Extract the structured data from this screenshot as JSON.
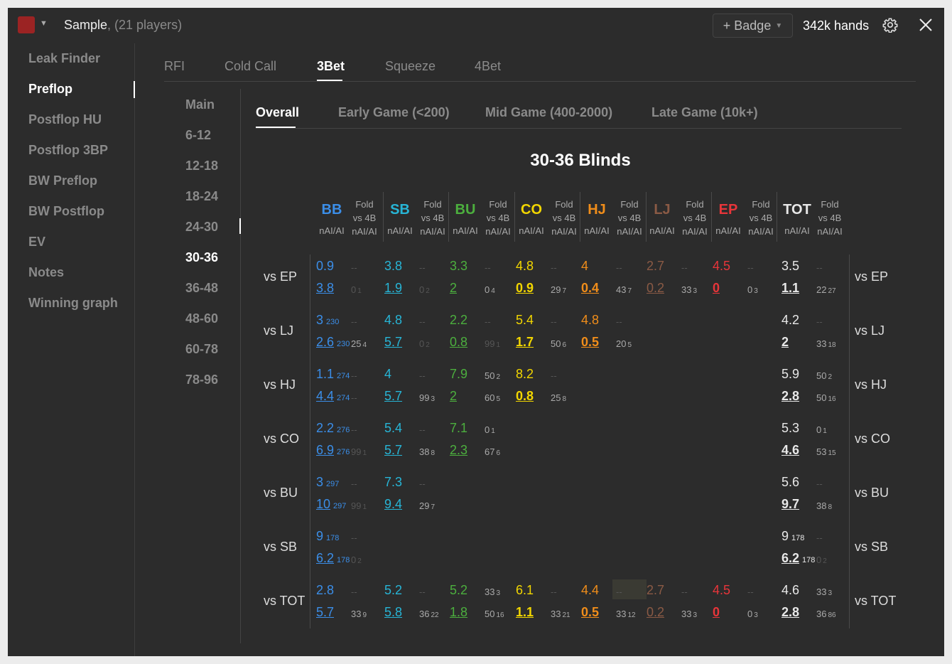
{
  "titlebar": {
    "swatch_color": "#9b2323",
    "title": "Sample",
    "subtitle": ", (21 players)",
    "badge_label": "+ Badge",
    "hands": "342k hands"
  },
  "sidebar": {
    "items": [
      {
        "label": "Leak Finder"
      },
      {
        "label": "Preflop",
        "active": true
      },
      {
        "label": "Postflop HU"
      },
      {
        "label": "Postflop 3BP"
      },
      {
        "label": "BW Preflop"
      },
      {
        "label": "BW Postflop"
      },
      {
        "label": "EV"
      },
      {
        "label": "Notes"
      },
      {
        "label": "Winning graph"
      }
    ]
  },
  "tabs": [
    "RFI",
    "Cold Call",
    "3Bet",
    "Squeeze",
    "4Bet"
  ],
  "ranges": [
    "Main",
    "6-12",
    "12-18",
    "18-24",
    "24-30",
    "30-36",
    "36-48",
    "48-60",
    "60-78",
    "78-96"
  ],
  "subtabs": [
    "Overall",
    "Early Game (<200)",
    "Mid Game (400-2000)",
    "Late Game (10k+)"
  ],
  "chart": {
    "title": "30-36 Blinds",
    "nai_label": "nAI/AI",
    "fold_label_1": "Fold",
    "fold_label_2": "vs 4B",
    "positions": [
      {
        "name": "BB",
        "color": "#3b8ee8"
      },
      {
        "name": "SB",
        "color": "#27b5d6"
      },
      {
        "name": "BU",
        "color": "#4caf3e"
      },
      {
        "name": "CO",
        "color": "#f2d600"
      },
      {
        "name": "HJ",
        "color": "#f08d1a"
      },
      {
        "name": "LJ",
        "color": "#8a5a45"
      },
      {
        "name": "EP",
        "color": "#e8353a"
      },
      {
        "name": "TOT",
        "color": "#e8e8e8"
      }
    ],
    "rows": [
      {
        "label": "vs EP",
        "cells": [
          {
            "pos": "BB",
            "top": "0.9",
            "bot": "3.8",
            "ftop": "--",
            "fbot": "0",
            "fbotc": "1"
          },
          {
            "pos": "SB",
            "top": "3.8",
            "bot": "1.9",
            "ftop": "--",
            "fbot": "0",
            "fbotc": "2"
          },
          {
            "pos": "BU",
            "top": "3.3",
            "bot": "2",
            "ftop": "--",
            "fbot": "0",
            "fbotc": "4"
          },
          {
            "pos": "CO",
            "top": "4.8",
            "bot": "0.9",
            "bold": true,
            "ftop": "--",
            "fbot": "29",
            "fbotc": "7"
          },
          {
            "pos": "HJ",
            "top": "4",
            "bot": "0.4",
            "bold": true,
            "ftop": "--",
            "fbot": "43",
            "fbotc": "7"
          },
          {
            "pos": "LJ",
            "top": "2.7",
            "bot": "0.2",
            "ftop": "--",
            "fbot": "33",
            "fbotc": "3"
          },
          {
            "pos": "EP",
            "top": "4.5",
            "bot": "0",
            "bold": true,
            "ftop": "--",
            "fbot": "0",
            "fbotc": "3"
          },
          {
            "pos": "TOT",
            "top": "3.5",
            "bot": "1.1",
            "bold": true,
            "ftop": "--",
            "fbot": "22",
            "fbotc": "27"
          }
        ]
      },
      {
        "label": "vs LJ",
        "cells": [
          {
            "pos": "BB",
            "top": "3",
            "topc": "230",
            "bot": "2.6",
            "botc": "230",
            "ftop": "--",
            "fbot": "25",
            "fbotc": "4"
          },
          {
            "pos": "SB",
            "top": "4.8",
            "bot": "5.7",
            "ftop": "--",
            "fbot": "0",
            "fbotc": "2"
          },
          {
            "pos": "BU",
            "top": "2.2",
            "bot": "0.8",
            "ftop": "--",
            "fbot": "99",
            "fbotc": "1"
          },
          {
            "pos": "CO",
            "top": "5.4",
            "bot": "1.7",
            "bold": true,
            "ftop": "--",
            "fbot": "50",
            "fbotc": "6"
          },
          {
            "pos": "HJ",
            "top": "4.8",
            "bot": "0.5",
            "bold": true,
            "ftop": "--",
            "fbot": "20",
            "fbotc": "5"
          },
          {
            "pos": "TOT",
            "top": "4.2",
            "bot": "2",
            "bold": true,
            "ftop": "--",
            "fbot": "33",
            "fbotc": "18"
          }
        ]
      },
      {
        "label": "vs HJ",
        "cells": [
          {
            "pos": "BB",
            "top": "1.1",
            "topc": "274",
            "bot": "4.4",
            "botc": "274",
            "ftop": "--",
            "fbot": "--"
          },
          {
            "pos": "SB",
            "top": "4",
            "bot": "5.7",
            "ftop": "--",
            "fbot": "99",
            "fbotc": "3"
          },
          {
            "pos": "BU",
            "top": "7.9",
            "bot": "2",
            "ftop": "50",
            "ftopc": "2",
            "fbot": "60",
            "fbotc": "5"
          },
          {
            "pos": "CO",
            "top": "8.2",
            "bot": "0.8",
            "bold": true,
            "ftop": "--",
            "fbot": "25",
            "fbotc": "8"
          },
          {
            "pos": "TOT",
            "top": "5.9",
            "bot": "2.8",
            "bold": true,
            "ftop": "50",
            "ftopc": "2",
            "fbot": "50",
            "fbotc": "16"
          }
        ]
      },
      {
        "label": "vs CO",
        "cells": [
          {
            "pos": "BB",
            "top": "2.2",
            "topc": "276",
            "bot": "6.9",
            "botc": "276",
            "ftop": "--",
            "fbot": "99",
            "fbotc": "1"
          },
          {
            "pos": "SB",
            "top": "5.4",
            "bot": "5.7",
            "ftop": "--",
            "fbot": "38",
            "fbotc": "8"
          },
          {
            "pos": "BU",
            "top": "7.1",
            "bot": "2.3",
            "ftop": "0",
            "ftopc": "1",
            "fbot": "67",
            "fbotc": "6"
          },
          {
            "pos": "TOT",
            "top": "5.3",
            "bot": "4.6",
            "bold": true,
            "ftop": "0",
            "ftopc": "1",
            "fbot": "53",
            "fbotc": "15"
          }
        ]
      },
      {
        "label": "vs BU",
        "cells": [
          {
            "pos": "BB",
            "top": "3",
            "topc": "297",
            "bot": "10",
            "botc": "297",
            "ftop": "--",
            "fbot": "99",
            "fbotc": "1"
          },
          {
            "pos": "SB",
            "top": "7.3",
            "bot": "9.4",
            "ftop": "--",
            "fbot": "29",
            "fbotc": "7"
          },
          {
            "pos": "TOT",
            "top": "5.6",
            "bot": "9.7",
            "bold": true,
            "ftop": "--",
            "fbot": "38",
            "fbotc": "8"
          }
        ]
      },
      {
        "label": "vs SB",
        "cells": [
          {
            "pos": "BB",
            "top": "9",
            "topc": "178",
            "bot": "6.2",
            "botc": "178",
            "ftop": "--",
            "fbot": "0",
            "fbotc": "2"
          },
          {
            "pos": "TOT",
            "top": "9",
            "topc": "178",
            "bot": "6.2",
            "botc": "178",
            "bold": true,
            "ftop": "--",
            "fbot": "0",
            "fbotc": "2"
          }
        ]
      },
      {
        "label": "vs TOT",
        "cells": [
          {
            "pos": "BB",
            "top": "2.8",
            "bot": "5.7",
            "ftop": "--",
            "fbot": "33",
            "fbotc": "9"
          },
          {
            "pos": "SB",
            "top": "5.2",
            "bot": "5.8",
            "ftop": "--",
            "fbot": "36",
            "fbotc": "22"
          },
          {
            "pos": "BU",
            "top": "5.2",
            "bot": "1.8",
            "ftop": "33",
            "ftopc": "3",
            "fbot": "50",
            "fbotc": "16"
          },
          {
            "pos": "CO",
            "top": "6.1",
            "bot": "1.1",
            "bold": true,
            "ftop": "--",
            "fbot": "33",
            "fbotc": "21"
          },
          {
            "pos": "HJ",
            "top": "4.4",
            "bot": "0.5",
            "bold": true,
            "ftop": "--",
            "fbot": "33",
            "fbotc": "12"
          },
          {
            "pos": "LJ",
            "top": "2.7",
            "bot": "0.2",
            "ftop": "--",
            "fbot": "33",
            "fbotc": "3"
          },
          {
            "pos": "EP",
            "top": "4.5",
            "bot": "0",
            "bold": true,
            "ftop": "--",
            "fbot": "0",
            "fbotc": "3"
          },
          {
            "pos": "TOT",
            "top": "4.6",
            "bot": "2.8",
            "bold": true,
            "ftop": "33",
            "ftopc": "3",
            "fbot": "36",
            "fbotc": "86"
          }
        ]
      }
    ]
  }
}
